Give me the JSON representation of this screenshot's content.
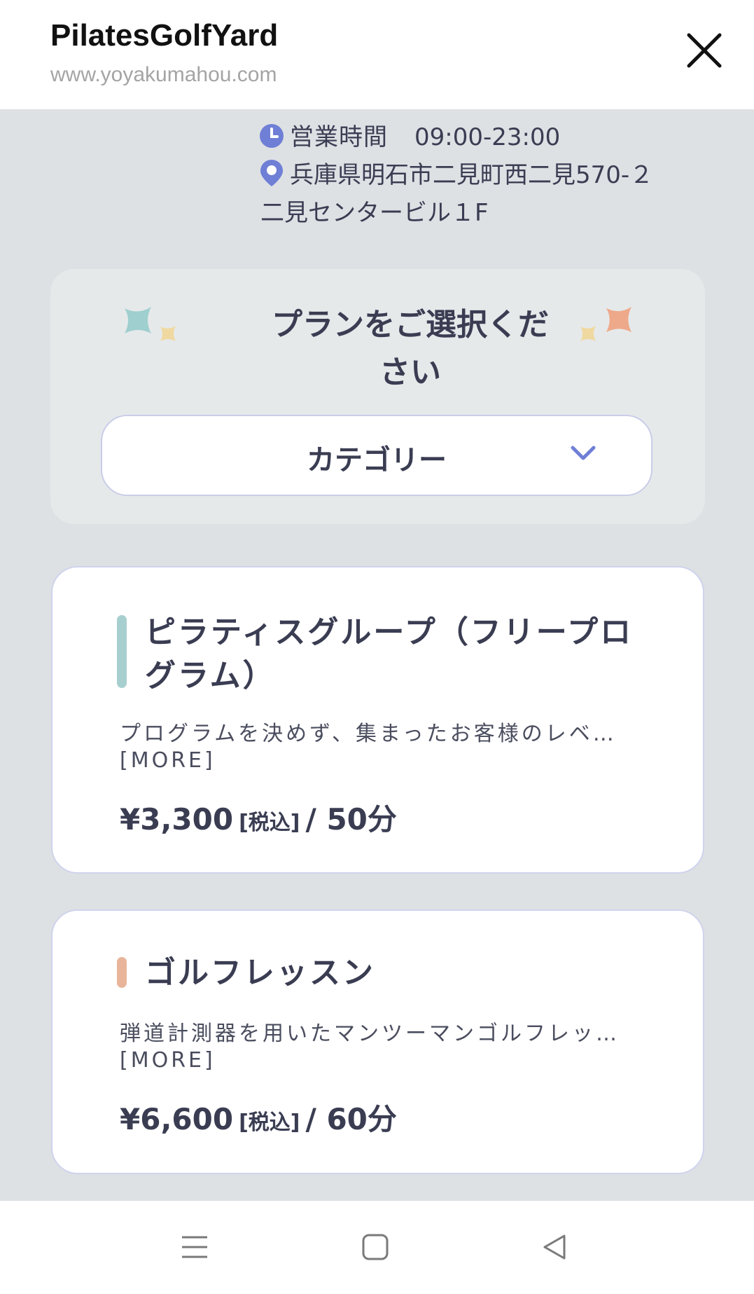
{
  "header": {
    "title": "PilatesGolfYard",
    "url": "www.yoyakumahou.com"
  },
  "info": {
    "hours_label": "営業時間",
    "hours_value": "09:00-23:00",
    "address_line1": "兵庫県明石市二見町西二見570‐２",
    "address_line2": "二見センタービル１F"
  },
  "plan_select": {
    "heading_line1": "プランをご選択くだ",
    "heading_line2": "さい",
    "category_label": "カテゴリー"
  },
  "plans": [
    {
      "title_line1": "ピラティスグループ（フリープロ",
      "title_line2": "グラム）",
      "description": "プログラムを決めず、集まったお客様のレベ…",
      "more": "[MORE]",
      "price": "¥3,300",
      "tax": "[税込]",
      "duration": "/ 50分",
      "accent": "#a8cfd0"
    },
    {
      "title_line1": "ゴルフレッスン",
      "description": "弾道計測器を用いたマンツーマンゴルフレッ…",
      "more": "[MORE]",
      "price": "¥6,600",
      "tax": "[税込]",
      "duration": "/ 60分",
      "accent": "#e8b59b"
    }
  ],
  "icons": {
    "close": "close-icon",
    "clock": "clock-icon",
    "location": "location-pin-icon",
    "chevron": "chevron-down-icon",
    "menu": "menu-icon",
    "home": "home-icon",
    "back": "back-icon"
  },
  "colors": {
    "accent_blue": "#6f7fd6",
    "background": "#dde1e4",
    "star_teal": "#9fcfcf",
    "star_yellow": "#f0d9a0",
    "star_orange": "#eea98a"
  }
}
